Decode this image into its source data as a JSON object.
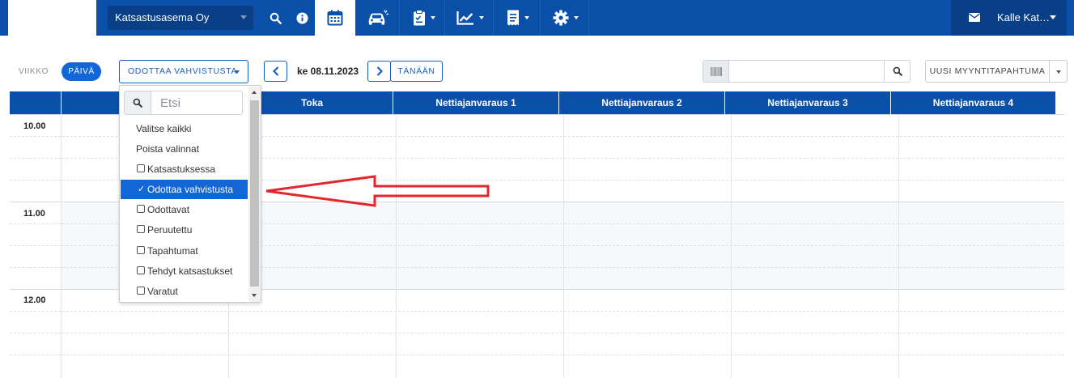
{
  "topbar": {
    "company": "Katsastusasema Oy",
    "icons": [
      "search-icon",
      "info-icon",
      "calendar-icon",
      "car-icon",
      "clipboard-icon",
      "chart-icon",
      "receipt-icon",
      "gear-icon"
    ],
    "user_name": "Kalle Kat…"
  },
  "toolbar": {
    "view_week": "VIIKKO",
    "view_day": "PÄIVÄ",
    "status_filter": "ODOTTAA VAHVISTUSTA",
    "date": "ke 08.11.2023",
    "today": "TÄNÄÄN",
    "new_sale": "UUSI MYYNTITAPAHTUMA"
  },
  "calendar": {
    "columns": [
      "",
      "Toka",
      "Nettiajanvaraus 1",
      "Nettiajanvaraus 2",
      "Nettiajanvaraus 3",
      "Nettiajanvaraus 4"
    ],
    "hours": [
      "10.00",
      "11.00",
      "12.00"
    ]
  },
  "dropdown": {
    "search_placeholder": "Etsi",
    "select_all": "Valitse kaikki",
    "clear_all": "Poista valinnat",
    "options": [
      {
        "label": "Katsastuksessa",
        "checked": false
      },
      {
        "label": "Odottaa vahvistusta",
        "checked": true
      },
      {
        "label": "Odottavat",
        "checked": false
      },
      {
        "label": "Peruutettu",
        "checked": false
      },
      {
        "label": "Tapahtumat",
        "checked": false
      },
      {
        "label": "Tehdyt katsastukset",
        "checked": false
      },
      {
        "label": "Varatut",
        "checked": false
      }
    ]
  },
  "colors": {
    "brand_blue": "#0a4fa8",
    "accent_blue": "#1266d6",
    "annotation_red": "#e3262b"
  }
}
